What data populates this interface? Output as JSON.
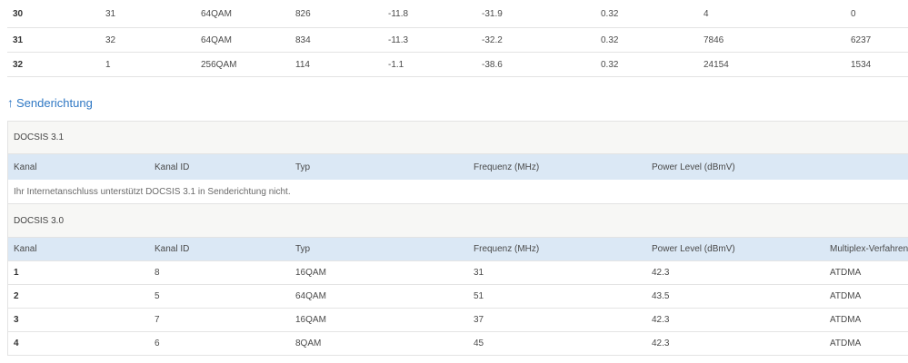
{
  "downstream_tail": {
    "rows": [
      [
        "30",
        "31",
        "64QAM",
        "826",
        "-11.8",
        "-31.9",
        "0.32",
        "4",
        "0"
      ],
      [
        "31",
        "32",
        "64QAM",
        "834",
        "-11.3",
        "-32.2",
        "0.32",
        "7846",
        "6237"
      ],
      [
        "32",
        "1",
        "256QAM",
        "114",
        "-1.1",
        "-38.6",
        "0.32",
        "24154",
        "1534"
      ]
    ]
  },
  "upstream": {
    "link_label": "Senderichtung",
    "arrow_glyph": "↑",
    "docsis31": {
      "title": "DOCSIS 3.1",
      "headers": [
        "Kanal",
        "Kanal ID",
        "Typ",
        "Frequenz (MHz)",
        "Power Level (dBmV)"
      ],
      "note": "Ihr Internetanschluss unterstützt DOCSIS 3.1 in Senderichtung nicht."
    },
    "docsis30": {
      "title": "DOCSIS 3.0",
      "headers": [
        "Kanal",
        "Kanal ID",
        "Typ",
        "Frequenz (MHz)",
        "Power Level (dBmV)",
        "Multiplex-Verfahren"
      ],
      "rows": [
        [
          "1",
          "8",
          "16QAM",
          "31",
          "42.3",
          "ATDMA"
        ],
        [
          "2",
          "5",
          "64QAM",
          "51",
          "43.5",
          "ATDMA"
        ],
        [
          "3",
          "7",
          "16QAM",
          "37",
          "42.3",
          "ATDMA"
        ],
        [
          "4",
          "6",
          "8QAM",
          "45",
          "42.3",
          "ATDMA"
        ]
      ]
    }
  },
  "colors": {
    "link": "#2f78c4",
    "header_bg": "#dbe8f5",
    "section_bg": "#f7f7f5"
  }
}
